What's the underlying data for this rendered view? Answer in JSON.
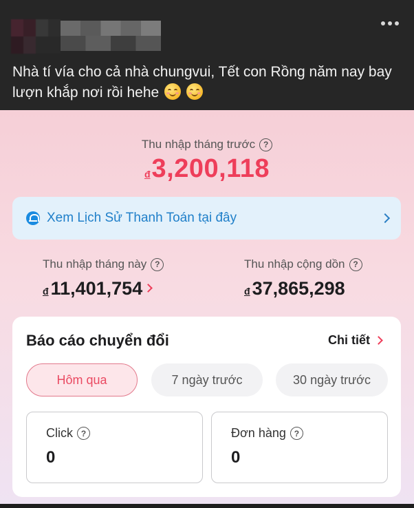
{
  "post": {
    "caption": "Nhà tí vía cho cả nhà chungvui, Tết con Rồng năm nay bay lượn khắp nơi rồi hehe",
    "emojis": [
      "smiling-face-icon",
      "smiling-face-icon"
    ]
  },
  "income": {
    "last_month_label": "Thu nhập tháng trước",
    "last_month_currency": "đ",
    "last_month_value": "3,200,118",
    "history_link": "Xem Lịch Sử Thanh Toán tại đây",
    "this_month_label": "Thu nhập tháng này",
    "this_month_currency": "đ",
    "this_month_value": "11,401,754",
    "cumulative_label": "Thu nhập cộng dồn",
    "cumulative_currency": "đ",
    "cumulative_value": "37,865,298",
    "help_glyph": "?"
  },
  "report": {
    "title": "Báo cáo chuyển đổi",
    "detail_label": "Chi tiết",
    "tabs": [
      {
        "label": "Hôm qua",
        "active": true
      },
      {
        "label": "7 ngày trước",
        "active": false
      },
      {
        "label": "30 ngày trước",
        "active": false
      }
    ],
    "metrics": [
      {
        "label": "Click",
        "value": "0"
      },
      {
        "label": "Đơn hàng",
        "value": "0"
      }
    ]
  },
  "colors": {
    "accent": "#ee3e5a",
    "link_blue": "#1f7fc9",
    "banner_bg": "#e3f1fb",
    "post_bg": "#262626"
  }
}
